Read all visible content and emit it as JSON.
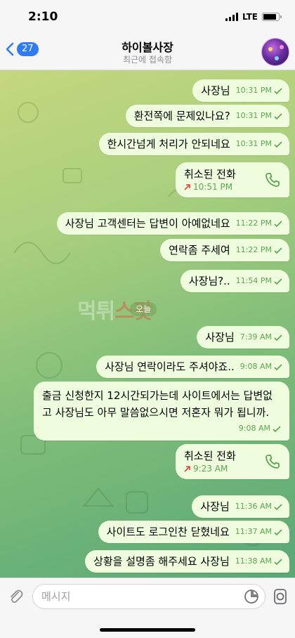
{
  "status_bar": {
    "time": "2:10",
    "network": "LTE",
    "battery_level": 0.88
  },
  "header": {
    "back_count": "27",
    "title": "하이볼사장",
    "subtitle": "최근에 접속함"
  },
  "watermark": {
    "part1": "먹튀",
    "part2": "스팟"
  },
  "date_divider": "오늘",
  "messages": [
    {
      "text": "사장님",
      "time": "10:31 PM"
    },
    {
      "text": "환전쪽에 문제있나요?",
      "time": "10:31 PM"
    },
    {
      "text": "한시간넘게 처리가 안되네요",
      "time": "10:31 PM"
    },
    {
      "text": "사장님 고객센터는 답변이 아예없네요",
      "time": "11:22 PM"
    },
    {
      "text": "연락좀 주세여",
      "time": "11:22 PM"
    },
    {
      "text": "사장님?..",
      "time": "11:54 PM"
    },
    {
      "text": "사장님",
      "time": "7:39 AM"
    },
    {
      "text": "사장님 연락이라도 주셔야죠..",
      "time": "9:08 AM"
    },
    {
      "text": "출금 신청한지 12시간되가는데 사이트에서는 답변없고 사장님도 아무 말씀없으시면 저혼자 뭐가 됩니까.",
      "time": "9:08 AM"
    },
    {
      "text": "사장님",
      "time": "11:36 AM"
    },
    {
      "text": "사이트도 로그인찬 닫혔네요",
      "time": "11:37 AM"
    },
    {
      "text": "상황을 설명좀 해주세요 사장님",
      "time": "11:38 AM"
    }
  ],
  "calls": [
    {
      "title": "취소된 전화",
      "time": "10:51 PM"
    },
    {
      "title": "취소된 전화",
      "time": "9:23 AM"
    }
  ],
  "input": {
    "placeholder": "메시지"
  },
  "colors": {
    "accent": "#2f7cf6",
    "bubble": "#effdde",
    "check": "#5aa551",
    "missed_call": "#e0443a"
  },
  "icons": [
    "chevron-left-icon",
    "paperclip-icon",
    "sticker-icon",
    "microphone-icon",
    "phone-icon",
    "double-check-icon",
    "call-arrow-icon"
  ]
}
